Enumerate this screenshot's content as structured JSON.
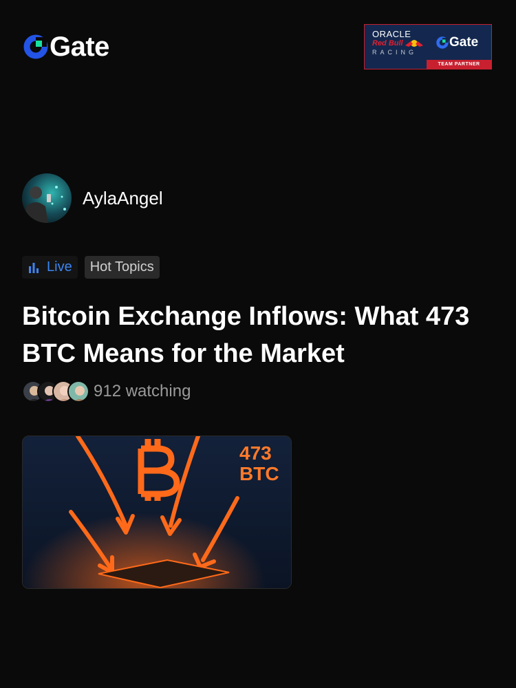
{
  "header": {
    "logo_text": "Gate",
    "partner": {
      "oracle": "ORACLE",
      "red_bull": "Red Bull",
      "racing": "RACING",
      "gate": "Gate",
      "badge": "TEAM PARTNER"
    }
  },
  "author": {
    "name": "AylaAngel"
  },
  "tags": [
    {
      "label": "Live",
      "icon": "bar-chart-icon",
      "color": "#3c86f4"
    },
    {
      "label": "Hot Topics"
    }
  ],
  "post": {
    "title": "Bitcoin Exchange Inflows: What 473 BTC Means for the Market",
    "watching": "912 watching",
    "image_text": {
      "amount": "473",
      "unit": "BTC"
    }
  },
  "colors": {
    "background": "#0a0a0a",
    "accent": "#3c86f4",
    "partner_red": "#c8202f"
  }
}
